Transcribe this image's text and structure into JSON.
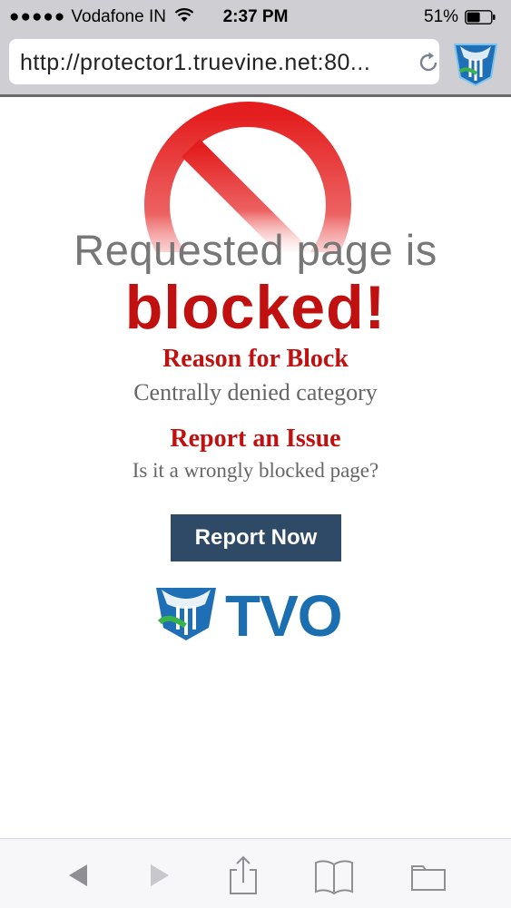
{
  "status_bar": {
    "carrier_dots": "●●●●●",
    "carrier": "Vodafone IN",
    "time": "2:37 PM",
    "battery": "51%"
  },
  "browser": {
    "url": "http://protector1.truevine.net:80...",
    "icons": [
      "wifi-icon",
      "battery-icon",
      "reload-icon",
      "extension-icon",
      "back-icon",
      "forward-icon",
      "share-icon",
      "bookmarks-icon",
      "tabs-icon"
    ]
  },
  "content": {
    "headline": "Requested page is",
    "blocked": "blocked!",
    "reason_label": "Reason for Block",
    "reason_value": "Centrally denied category",
    "report_label": "Report an Issue",
    "report_question": "Is it a wrongly blocked page?",
    "report_button": "Report Now",
    "logo_text": "TVO"
  },
  "colors": {
    "accent_red": "#c01010",
    "button_bg": "#2e4a66",
    "logo_blue": "#1b6fb0",
    "chrome_gray": "#cfcfd3"
  }
}
